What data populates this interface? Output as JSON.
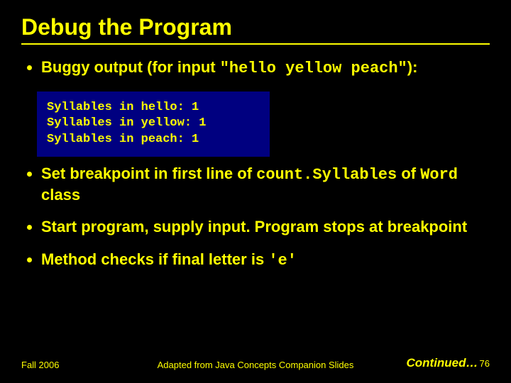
{
  "title": "Debug the Program",
  "bullets": [
    {
      "prefix": "Buggy output (for input ",
      "code": "\"hello yellow peach\"",
      "suffix": "):"
    }
  ],
  "output_lines": "Syllables in hello: 1\nSyllables in yellow: 1\nSyllables in peach: 1",
  "bullet2": {
    "t1": "Set breakpoint in first line of ",
    "c1": "count.Syllables",
    "t2": " of ",
    "c2": "Word",
    "t3": " class"
  },
  "bullet3": "Start program, supply input. Program stops at breakpoint",
  "bullet4": {
    "t1": "Method checks if final letter is ",
    "c1": "'e'"
  },
  "footer": {
    "left": "Fall 2006",
    "center": "Adapted from Java Concepts Companion Slides",
    "continued": "Continued…",
    "page": "76"
  }
}
